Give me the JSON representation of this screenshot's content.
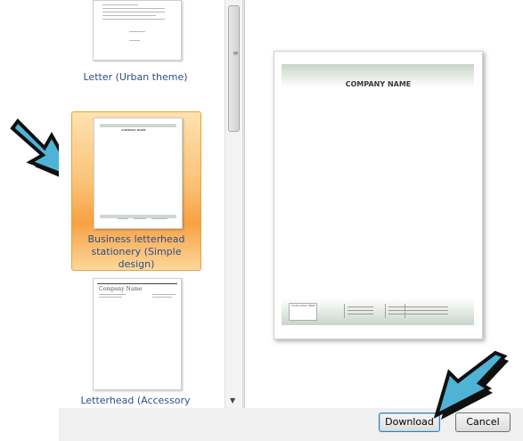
{
  "templates": [
    {
      "label": "Letter (Urban theme)"
    },
    {
      "label": "Business letterhead stationery (Simple design)",
      "selected": true
    },
    {
      "label": "Letterhead (Accessory"
    }
  ],
  "thumbnail_text": {
    "company_name": "COMPANY NAME",
    "accessory_company": "Company Name"
  },
  "preview": {
    "company_name": "COMPANY NAME",
    "footer_box": "YOUR LOGO HERE"
  },
  "buttons": {
    "download": "Download",
    "cancel": "Cancel"
  },
  "colors": {
    "selection_orange": "#f7a143",
    "label_blue": "#2a4f8a",
    "arrow_fill": "#4fb3d6"
  },
  "icons": {
    "scroll_grip": "≡",
    "scroll_down": "▼"
  }
}
